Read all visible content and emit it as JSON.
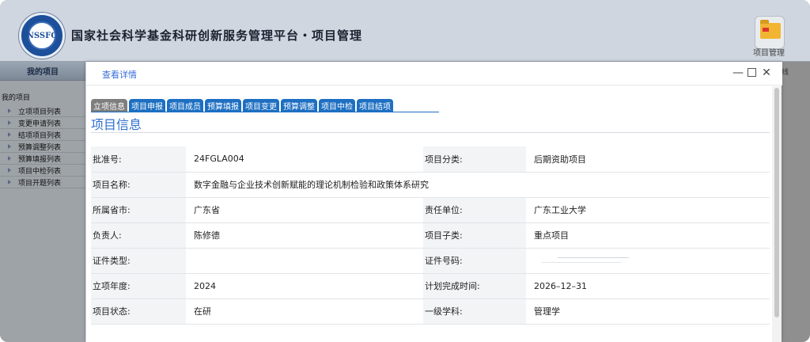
{
  "header": {
    "logo_text": "NSSFC",
    "title": "国家社会科学基金科研创新服务管理平台・项目管理",
    "right_label": "项目管理"
  },
  "sidebar": {
    "title": "我的项目",
    "root": "我的项目",
    "items": [
      {
        "label": "立项项目列表"
      },
      {
        "label": "变更申请列表"
      },
      {
        "label": "结项项目列表"
      },
      {
        "label": "预算调整列表"
      },
      {
        "label": "预算填报列表"
      },
      {
        "label": "项目中检列表"
      },
      {
        "label": "项目开题列表"
      }
    ]
  },
  "background": {
    "right_text": "线"
  },
  "modal": {
    "title": "查看详情",
    "tabs": [
      {
        "label": "立项信息",
        "active": true
      },
      {
        "label": "项目申报"
      },
      {
        "label": "项目成员"
      },
      {
        "label": "预算填报"
      },
      {
        "label": "项目变更"
      },
      {
        "label": "预算调整"
      },
      {
        "label": "项目中检"
      },
      {
        "label": "项目结项"
      }
    ],
    "section_title": "项目信息",
    "fields": {
      "approval_no": {
        "label": "批准号:",
        "value": "24FGLA004"
      },
      "category": {
        "label": "项目分类:",
        "value": "后期资助项目"
      },
      "name": {
        "label": "项目名称:",
        "value": "数字金融与企业技术创新赋能的理论机制检验和政策体系研究"
      },
      "province": {
        "label": "所属省市:",
        "value": "广东省"
      },
      "unit": {
        "label": "责任单位:",
        "value": "广东工业大学"
      },
      "leader": {
        "label": "负责人:",
        "value": "陈修德"
      },
      "subtype": {
        "label": "项目子类:",
        "value": "重点项目"
      },
      "id_type": {
        "label": "证件类型:",
        "value": ""
      },
      "id_no": {
        "label": "证件号码:",
        "value": ""
      },
      "year": {
        "label": "立项年度:",
        "value": "2024"
      },
      "plan_end": {
        "label": "计划完成时间:",
        "value": "2026–12–31"
      },
      "status": {
        "label": "项目状态:",
        "value": "在研"
      },
      "discipline": {
        "label": "一级学科:",
        "value": "管理学"
      }
    }
  },
  "colors": {
    "accent": "#1d6fc2",
    "title_blue": "#2f6fd0",
    "active_tab": "#7e7e7e"
  },
  "icons": {
    "logo": "nssfc-logo-icon",
    "header_app": "folder-icon",
    "minimize": "minimize-icon",
    "maximize": "maximize-icon",
    "close": "close-icon",
    "tree_item": "triangle-right-icon"
  }
}
